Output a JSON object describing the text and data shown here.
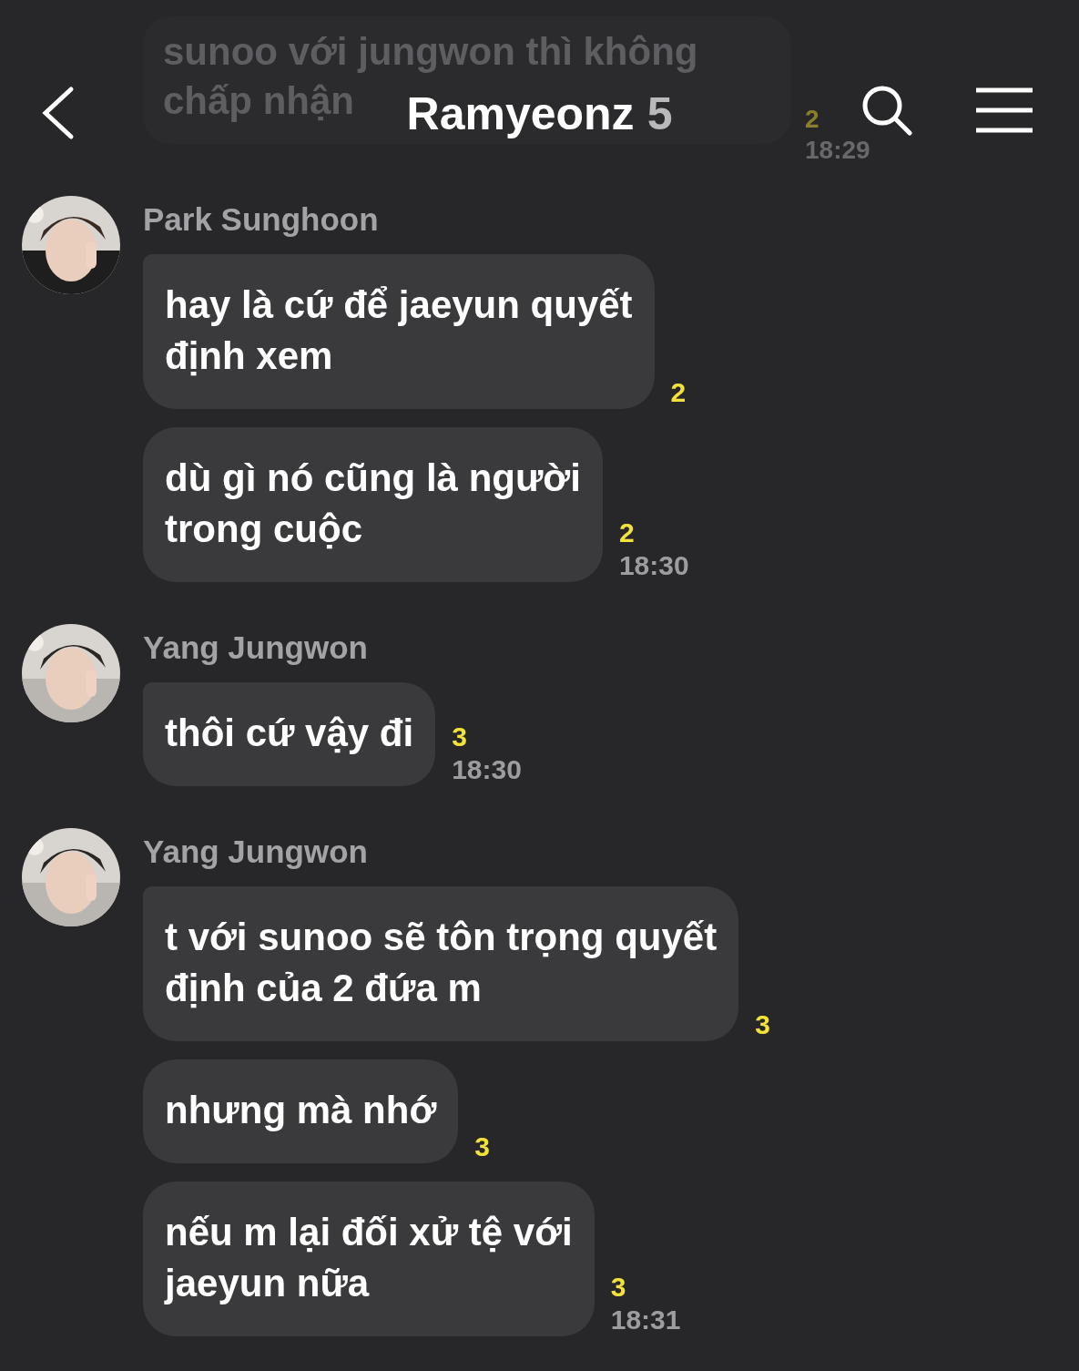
{
  "header": {
    "title": "Ramyeonz",
    "member_count": "5"
  },
  "faded_message": {
    "lines": [
      "sunoo với jungwon thì không",
      "chấp nhận"
    ],
    "read_count": "2",
    "time": "18:29"
  },
  "groups": [
    {
      "sender": "Park Sunghoon",
      "messages": [
        {
          "text": "hay là cứ để jaeyun quyết\nđịnh xem",
          "read_count": "2"
        },
        {
          "text": "dù gì nó cũng là người\ntrong cuộc",
          "read_count": "2",
          "time": "18:30"
        }
      ]
    },
    {
      "sender": "Yang Jungwon",
      "messages": [
        {
          "text": "thôi cứ vậy đi",
          "read_count": "3",
          "time": "18:30"
        }
      ]
    },
    {
      "sender": "Yang Jungwon",
      "messages": [
        {
          "text": "t với sunoo sẽ tôn trọng quyết\nđịnh của 2 đứa m",
          "read_count": "3"
        },
        {
          "text": "nhưng mà nhớ",
          "read_count": "3"
        },
        {
          "text": "nếu m lại đối xử tệ với\njaeyun nữa",
          "read_count": "3",
          "time": "18:31"
        }
      ]
    }
  ]
}
